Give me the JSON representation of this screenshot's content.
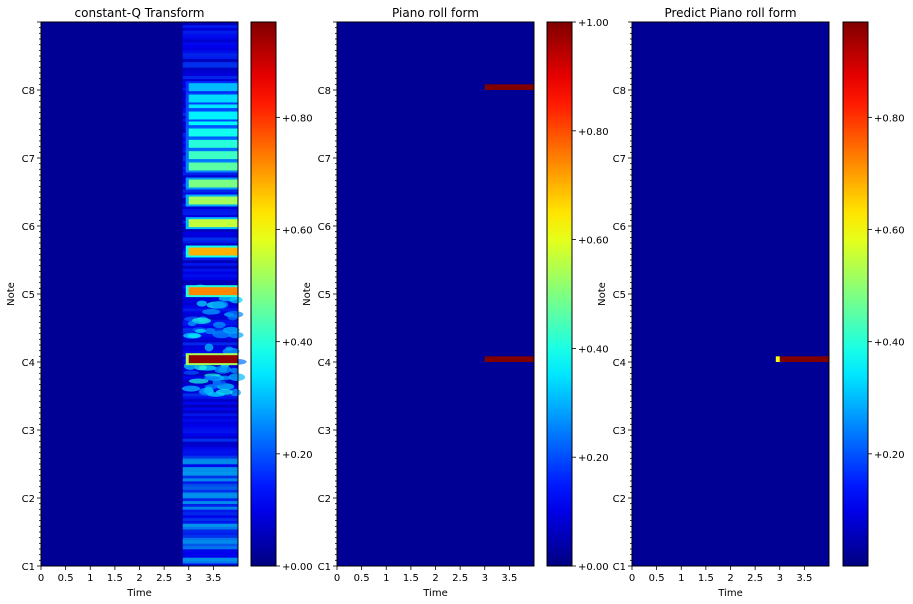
{
  "chart_data": [
    {
      "type": "heatmap",
      "title": "constant-Q Transform",
      "xlabel": "Time",
      "ylabel": "Note",
      "xlim": [
        0,
        4.0
      ],
      "ylim": [
        "C1",
        "B8"
      ],
      "x_ticks": [
        "0",
        "0.5",
        "1",
        "1.5",
        "2",
        "2.5",
        "3",
        "3.5"
      ],
      "x_tick_values": [
        0,
        0.5,
        1,
        1.5,
        2,
        2.5,
        3,
        3.5
      ],
      "y_ticks": [
        "C1",
        "C2",
        "C3",
        "C4",
        "C5",
        "C6",
        "C7",
        "C8"
      ],
      "colormap": "jet",
      "colorbar": {
        "range": [
          0,
          0.97
        ],
        "ticks": [
          0,
          0.2,
          0.4,
          0.6,
          0.8
        ],
        "tick_labels": [
          "+0.00",
          "+0.20",
          "+0.40",
          "+0.60",
          "+0.80"
        ]
      },
      "onset_time": 3.0,
      "bands": [
        {
          "note": "C4",
          "value": 0.95
        },
        {
          "note": "C5",
          "value": 0.72
        },
        {
          "note": "G5",
          "value": 0.68
        },
        {
          "note": "C6",
          "value": 0.55
        },
        {
          "note": "E6",
          "value": 0.52
        },
        {
          "note": "G6",
          "value": 0.48
        },
        {
          "note": "A#6",
          "value": 0.45
        },
        {
          "note": "C7",
          "value": 0.42
        },
        {
          "note": "D7",
          "value": 0.4
        },
        {
          "note": "E7",
          "value": 0.38
        },
        {
          "note": "F#7",
          "value": 0.36
        },
        {
          "note": "G7",
          "value": 0.35
        },
        {
          "note": "A7",
          "value": 0.34
        },
        {
          "note": "A#7",
          "value": 0.33
        },
        {
          "note": "C8",
          "value": 0.3
        }
      ]
    },
    {
      "type": "heatmap",
      "title": "Piano roll form",
      "xlabel": "Time",
      "ylabel": "Note",
      "xlim": [
        0,
        4.0
      ],
      "ylim": [
        "C1",
        "B8"
      ],
      "x_ticks": [
        "0",
        "0.5",
        "1",
        "1.5",
        "2",
        "2.5",
        "3",
        "3.5"
      ],
      "x_tick_values": [
        0,
        0.5,
        1,
        1.5,
        2,
        2.5,
        3,
        3.5
      ],
      "y_ticks": [
        "C1",
        "C2",
        "C3",
        "C4",
        "C5",
        "C6",
        "C7",
        "C8"
      ],
      "colormap": "jet",
      "colorbar": {
        "range": [
          0,
          1.0
        ],
        "ticks": [
          0,
          0.2,
          0.4,
          0.6,
          0.8,
          1.0
        ],
        "tick_labels": [
          "+0.00",
          "+0.20",
          "+0.40",
          "+0.60",
          "+0.80",
          "+1.00"
        ]
      },
      "notes": [
        {
          "note": "C4",
          "start": 3.0,
          "end": 4.0,
          "value": 1.0
        },
        {
          "note": "C8",
          "start": 3.0,
          "end": 4.0,
          "value": 1.0
        }
      ]
    },
    {
      "type": "heatmap",
      "title": "Predict Piano roll form",
      "xlabel": "Time",
      "ylabel": "Note",
      "xlim": [
        0,
        4.0
      ],
      "ylim": [
        "C1",
        "B8"
      ],
      "x_ticks": [
        "0",
        "0.5",
        "1",
        "1.5",
        "2",
        "2.5",
        "3",
        "3.5"
      ],
      "x_tick_values": [
        0,
        0.5,
        1,
        1.5,
        2,
        2.5,
        3,
        3.5
      ],
      "y_ticks": [
        "C1",
        "C2",
        "C3",
        "C4",
        "C5",
        "C6",
        "C7",
        "C8"
      ],
      "colormap": "jet",
      "colorbar": {
        "range": [
          0,
          0.97
        ],
        "ticks": [
          0.2,
          0.4,
          0.6,
          0.8
        ],
        "tick_labels": [
          "+0.20",
          "+0.40",
          "+0.60",
          "+0.80"
        ]
      },
      "notes": [
        {
          "note": "C4",
          "start": 3.0,
          "end": 4.0,
          "value": 0.97
        },
        {
          "note": "C4",
          "start": 2.92,
          "end": 3.0,
          "value": 0.6
        }
      ]
    }
  ]
}
